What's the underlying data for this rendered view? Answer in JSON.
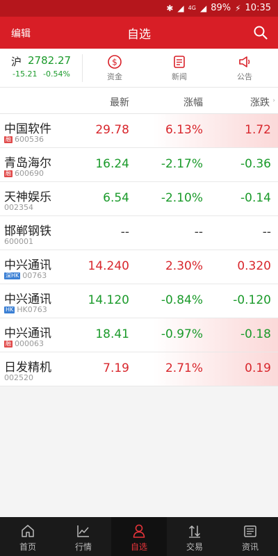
{
  "status": {
    "battery": "89%",
    "time": "10:35"
  },
  "topbar": {
    "edit_label": "编辑",
    "title": "自选"
  },
  "index": {
    "market": "沪",
    "value": "2782.27",
    "change": "-15.21",
    "percent": "-0.54%"
  },
  "quick_links": [
    {
      "label": "资金",
      "icon": "money-icon"
    },
    {
      "label": "新闻",
      "icon": "news-icon"
    },
    {
      "label": "公告",
      "icon": "announcement-icon"
    }
  ],
  "columns": {
    "latest": "最新",
    "change_pct": "涨幅",
    "change_amt": "涨跌"
  },
  "stocks": [
    {
      "name": "中国软件",
      "code": "600536",
      "tag": "融",
      "price": "29.78",
      "pct": "6.13%",
      "chg": "1.72"
    },
    {
      "name": "青岛海尔",
      "code": "600690",
      "tag": "融",
      "price": "16.24",
      "pct": "-2.17%",
      "chg": "-0.36"
    },
    {
      "name": "天神娱乐",
      "code": "002354",
      "tag": "",
      "price": "6.54",
      "pct": "-2.10%",
      "chg": "-0.14"
    },
    {
      "name": "邯郸钢铁",
      "code": "600001",
      "tag": "",
      "price": "--",
      "pct": "--",
      "chg": "--"
    },
    {
      "name": "中兴通讯",
      "code": "00763",
      "tag": "深HK",
      "price": "14.240",
      "pct": "2.30%",
      "chg": "0.320"
    },
    {
      "name": "中兴通讯",
      "code": "HK0763",
      "tag": "HK",
      "price": "14.120",
      "pct": "-0.84%",
      "chg": "-0.120"
    },
    {
      "name": "中兴通讯",
      "code": "000063",
      "tag": "融",
      "price": "18.41",
      "pct": "-0.97%",
      "chg": "-0.18"
    },
    {
      "name": "日发精机",
      "code": "002520",
      "tag": "",
      "price": "7.19",
      "pct": "2.71%",
      "chg": "0.19"
    }
  ],
  "tabs": [
    {
      "label": "首页",
      "icon": "home-icon"
    },
    {
      "label": "行情",
      "icon": "market-chart-icon"
    },
    {
      "label": "自选",
      "icon": "watchlist-icon"
    },
    {
      "label": "交易",
      "icon": "trade-icon"
    },
    {
      "label": "资讯",
      "icon": "info-icon"
    }
  ],
  "colors": {
    "brand_red": "#d81e26",
    "rise": "#d8262c",
    "fall": "#1a9a2a"
  }
}
